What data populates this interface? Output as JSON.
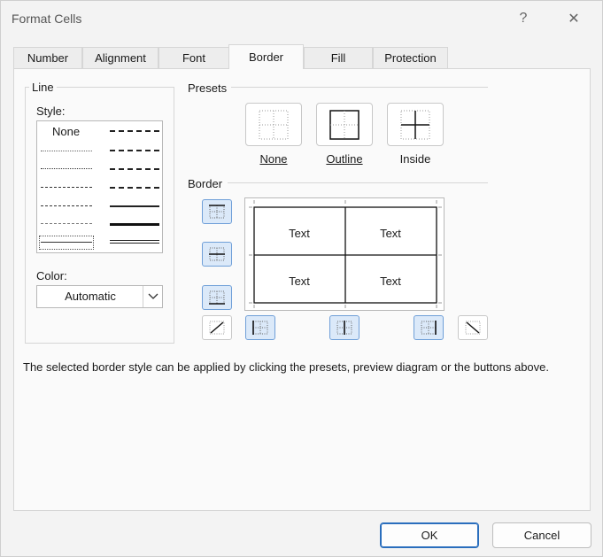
{
  "dialog": {
    "title": "Format Cells",
    "help_glyph": "?",
    "close_glyph": "✕"
  },
  "tabs": [
    "Number",
    "Alignment",
    "Font",
    "Border",
    "Fill",
    "Protection"
  ],
  "active_tab": "Border",
  "line": {
    "group_title": "Line",
    "style_label": "Style:",
    "style_none": "None",
    "color_label": "Color:",
    "color_value": "Automatic"
  },
  "presets": {
    "title": "Presets",
    "items": [
      "None",
      "Outline",
      "Inside"
    ]
  },
  "border": {
    "title": "Border",
    "preview_text": [
      "Text",
      "Text",
      "Text",
      "Text"
    ]
  },
  "help_text": "The selected border style can be applied by clicking the presets, preview diagram or the buttons above.",
  "buttons": {
    "ok": "OK",
    "cancel": "Cancel"
  },
  "colors": {
    "accent": "#2a6ebd",
    "selected_fill": "#dbe9f9"
  }
}
